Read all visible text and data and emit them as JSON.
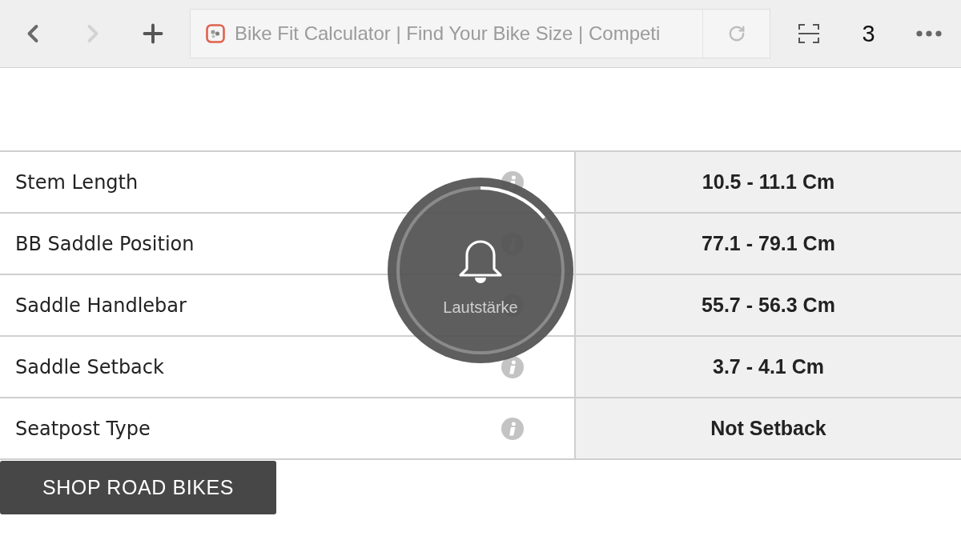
{
  "toolbar": {
    "back": {
      "disabled": false
    },
    "forward": {
      "disabled": true
    },
    "address": {
      "title": "Bike Fit Calculator | Find Your Bike Size | Competi"
    },
    "tab_count": "3"
  },
  "fit_table": {
    "rows": [
      {
        "label": "Stem Length",
        "value": "10.5 - 11.1 Cm"
      },
      {
        "label": "BB Saddle Position",
        "value": "77.1 - 79.1 Cm"
      },
      {
        "label": "Saddle Handlebar",
        "value": "55.7 - 56.3 Cm"
      },
      {
        "label": "Saddle Setback",
        "value": "3.7 - 4.1 Cm"
      },
      {
        "label": "Seatpost Type",
        "value": "Not Setback"
      }
    ]
  },
  "shop_button": {
    "label": "SHOP ROAD BIKES"
  },
  "volume_hud": {
    "label": "Lautstärke",
    "level": 0.14
  }
}
